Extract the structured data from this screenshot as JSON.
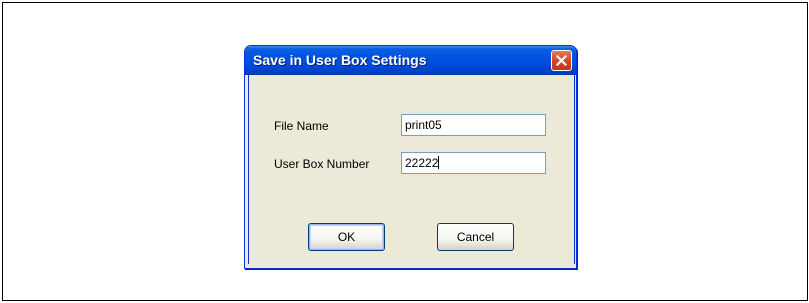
{
  "dialog": {
    "title": "Save in User Box Settings",
    "close_icon": "close-x-icon",
    "fields": {
      "file_name": {
        "label": "File Name",
        "value": "print05"
      },
      "user_box_number": {
        "label": "User Box Number",
        "value": "22222"
      }
    },
    "buttons": {
      "ok": "OK",
      "cancel": "Cancel"
    }
  },
  "colors": {
    "titlebar": "#0052e0",
    "dialog_bg": "#ece9d8",
    "close_button": "#d6452a",
    "field_border": "#7f9db9"
  }
}
